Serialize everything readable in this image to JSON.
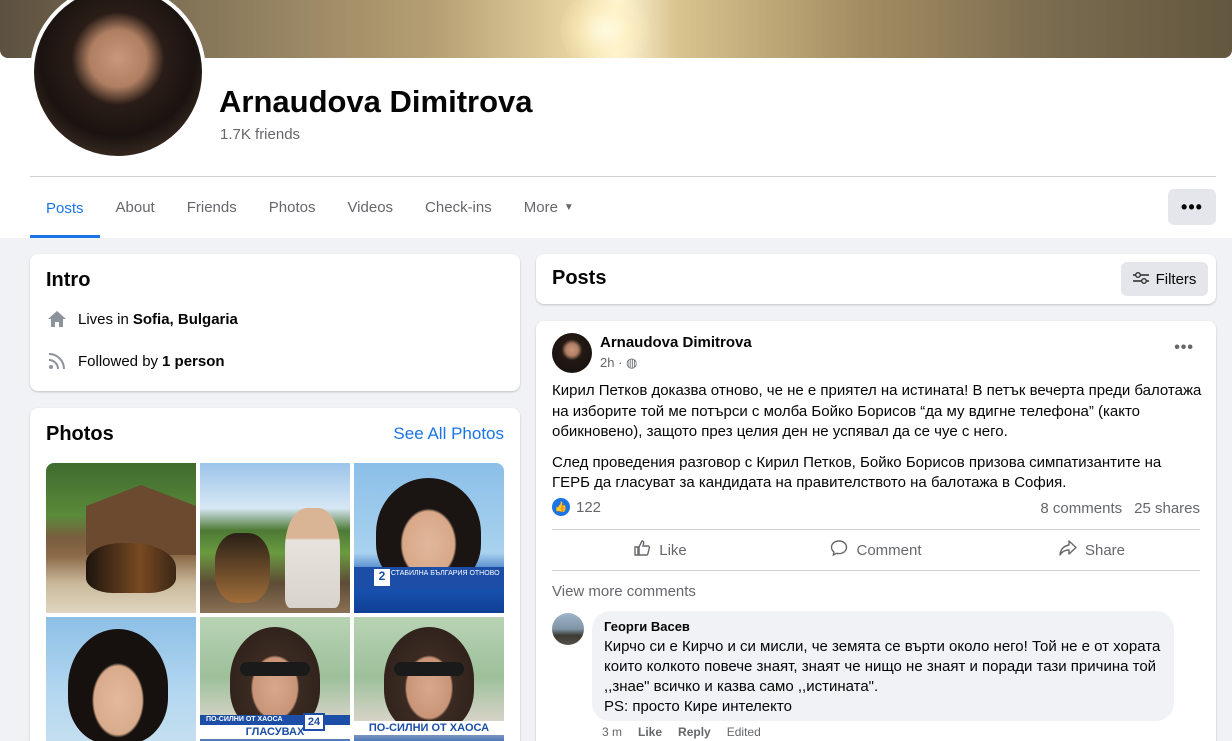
{
  "profile": {
    "name": "Arnaudova Dimitrova",
    "friends": "1.7K friends"
  },
  "tabs": [
    {
      "label": "Posts",
      "active": true
    },
    {
      "label": "About"
    },
    {
      "label": "Friends"
    },
    {
      "label": "Photos"
    },
    {
      "label": "Videos"
    },
    {
      "label": "Check-ins"
    },
    {
      "label": "More"
    }
  ],
  "more_icon": "•••",
  "intro": {
    "title": "Intro",
    "lives_prefix": "Lives in",
    "lives_place": "Sofia, Bulgaria",
    "followed_prefix": "Followed by",
    "followed_count": "1 person"
  },
  "photos": {
    "title": "Photos",
    "see_all": "See All Photos",
    "tv_number": "2",
    "tv_caption": "ЗА СТАБИЛНА БЪЛГАРИЯ ОТНОВО",
    "band_top_1": "ПО-СИЛНИ ОТ ХАОСА",
    "band_bottom_1": "ГЛАСУВАХ",
    "badge": "24",
    "band_bottom_2": "ПО-СИЛНИ ОТ ХАОСА"
  },
  "posts_header": {
    "title": "Posts",
    "filters": "Filters"
  },
  "post": {
    "author": "Arnaudova Dimitrova",
    "time": "2h · ◍",
    "paragraph1": "Кирил Петков доказва отново, че не е приятел на истината! В петък вечерта преди балотажа на изборите той ме потърси с молба Бойко Борисов “да му вдигне телефона” (както обикновено), защото през целия ден не успявал да се чуе с него.",
    "paragraph2": "След проведения разговор с Кирил Петков,  Бойко Борисов призова симпатизантите на ГЕРБ да гласуват за кандидата на правителството на балотажа в София.",
    "reactions": "122",
    "comments": "8 comments",
    "shares": "25 shares",
    "like": "Like",
    "comment": "Comment",
    "share": "Share",
    "view_more": "View more comments"
  },
  "comment": {
    "author": "Георги Васев",
    "text1": "Кирчо си е Кирчо и си мисли, че земята се върти около него! Той не е от хората които колкото повече знаят, знаят че нищо не знаят и поради тази причина той ,,знае\" всичко и казва само ,,истината\".",
    "text2": "PS: просто Кире интелекто",
    "time": "3 m",
    "like": "Like",
    "reply": "Reply",
    "edited": "Edited"
  },
  "colors": {
    "accent": "#1b74e4",
    "background": "#f0f2f5",
    "muted": "#65676b"
  }
}
